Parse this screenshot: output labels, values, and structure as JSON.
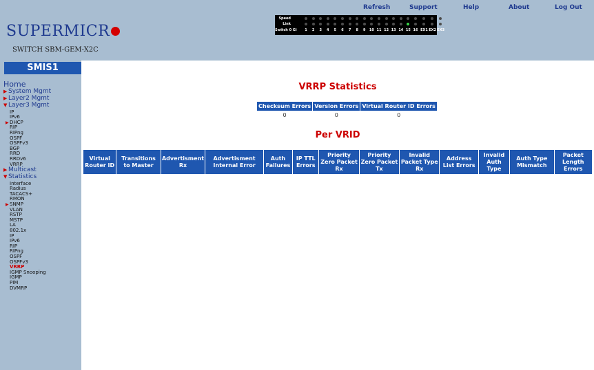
{
  "header": {
    "logo_text": "SUPERMICR",
    "switch_model": "SWITCH SBM-GEM-X2C",
    "nav": [
      "Refresh",
      "Support",
      "Help",
      "About",
      "Log Out"
    ]
  },
  "port_panel": {
    "speed_label": "Speed",
    "link_label": "Link",
    "switch_label": "Switch 0 Gi",
    "ports": [
      "1",
      "2",
      "3",
      "4",
      "5",
      "6",
      "7",
      "8",
      "9",
      "10",
      "11",
      "12",
      "13",
      "14",
      "15",
      "16",
      "EX1",
      "EX2",
      "EX3"
    ],
    "link_on_port": "15",
    "colors": {
      "led_off": "#4d4d4d",
      "led_on": "#38d64a"
    }
  },
  "sidebar": {
    "title": "SMIS1",
    "home": "Home",
    "sections": [
      {
        "label": "System Mgmt",
        "expanded": false
      },
      {
        "label": "Layer2 Mgmt",
        "expanded": false
      },
      {
        "label": "Layer3 Mgmt",
        "expanded": true,
        "items": [
          "IP",
          "IPv6",
          "DHCP",
          "RIP",
          "RIPng",
          "OSPF",
          "OSPFv3",
          "BGP",
          "RRD",
          "RRDv6",
          "VRRP"
        ]
      },
      {
        "label": "Multicast",
        "expanded": false
      },
      {
        "label": "Statistics",
        "expanded": true,
        "items": [
          "Interface",
          "Radius",
          "TACACS+",
          "RMON",
          "SNMP",
          "VLAN",
          "RSTP",
          "MSTP",
          "LA",
          "802.1x",
          "IP",
          "IPv6",
          "RIP",
          "RIPng",
          "OSPF",
          "OSPFv3",
          "VRRP",
          "IGMP Snooping",
          "IGMP",
          "PIM",
          "DVMRP"
        ]
      }
    ],
    "active_item": "VRRP"
  },
  "main": {
    "title": "VRRP Statistics",
    "stats_table": {
      "headers": [
        "Checksum Errors",
        "Version Errors",
        "Virtual Router ID Errors"
      ],
      "values": [
        "0",
        "0",
        "0"
      ]
    },
    "per_vrid_title": "Per VRID",
    "vrid_headers": [
      "Virtual Router ID",
      "Transitions to Master",
      "Advertisment Rx",
      "Advertisment Internal Error",
      "Auth Failures",
      "IP TTL Errors",
      "Priority Zero Packet Rx",
      "Priority Zero Packet Tx",
      "Invalid Packet Type Rx",
      "Address List Errors",
      "Invalid Auth Type",
      "Auth Type Mismatch",
      "Packet Length Errors"
    ]
  },
  "colors": {
    "header_bg": "#a8bdd1",
    "table_header_bg": "#1f57b0",
    "title_red": "#cc0000",
    "nav_blue": "#1f3a8f"
  }
}
